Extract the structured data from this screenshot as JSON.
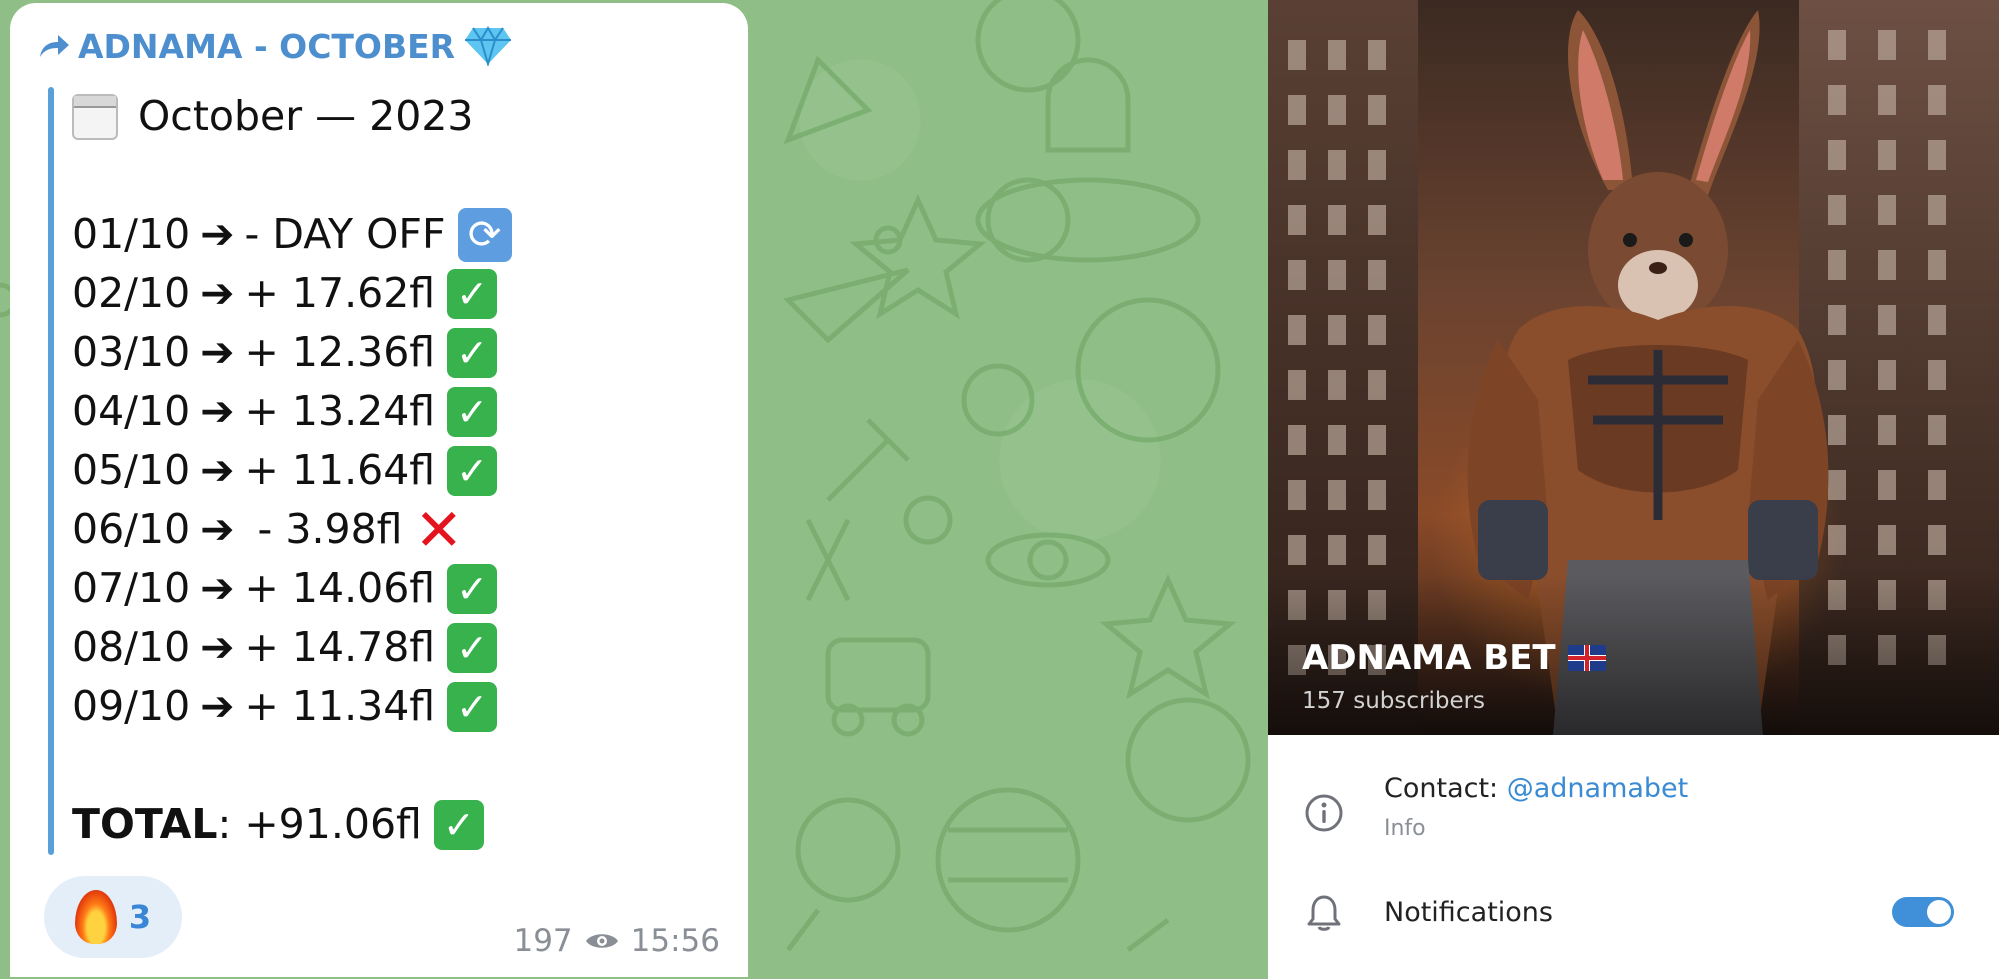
{
  "message": {
    "forwarded_from": "ADNAMA - OCTOBER",
    "header_emoji": "gem-icon",
    "title": "October — 2023",
    "entries": [
      {
        "date": "01/10",
        "value": "- DAY OFF",
        "status": "refresh"
      },
      {
        "date": "02/10",
        "value": "+ 17.62fl",
        "status": "check"
      },
      {
        "date": "03/10",
        "value": "+ 12.36fl",
        "status": "check"
      },
      {
        "date": "04/10",
        "value": "+ 13.24fl",
        "status": "check"
      },
      {
        "date": "05/10",
        "value": "+ 11.64fl",
        "status": "check"
      },
      {
        "date": "06/10",
        "value": " - 3.98fl",
        "status": "cross"
      },
      {
        "date": "07/10",
        "value": "+ 14.06fl",
        "status": "check"
      },
      {
        "date": "08/10",
        "value": "+ 14.78fl",
        "status": "check"
      },
      {
        "date": "09/10",
        "value": "+ 11.34fl",
        "status": "check"
      }
    ],
    "total_label": "TOTAL",
    "total_value": ": +91.06fl",
    "reaction_count": "3",
    "views": "197",
    "time": "15:56",
    "accent_color": "#4d8fce"
  },
  "channel": {
    "name": "ADNAMA BET",
    "subscribers": "157 subscribers",
    "contact_label": "Contact: ",
    "contact_handle": "@adnamabet",
    "info_label": "Info",
    "notifications_label": "Notifications",
    "notifications_on": true,
    "toggle_color": "#3f8fd9"
  }
}
